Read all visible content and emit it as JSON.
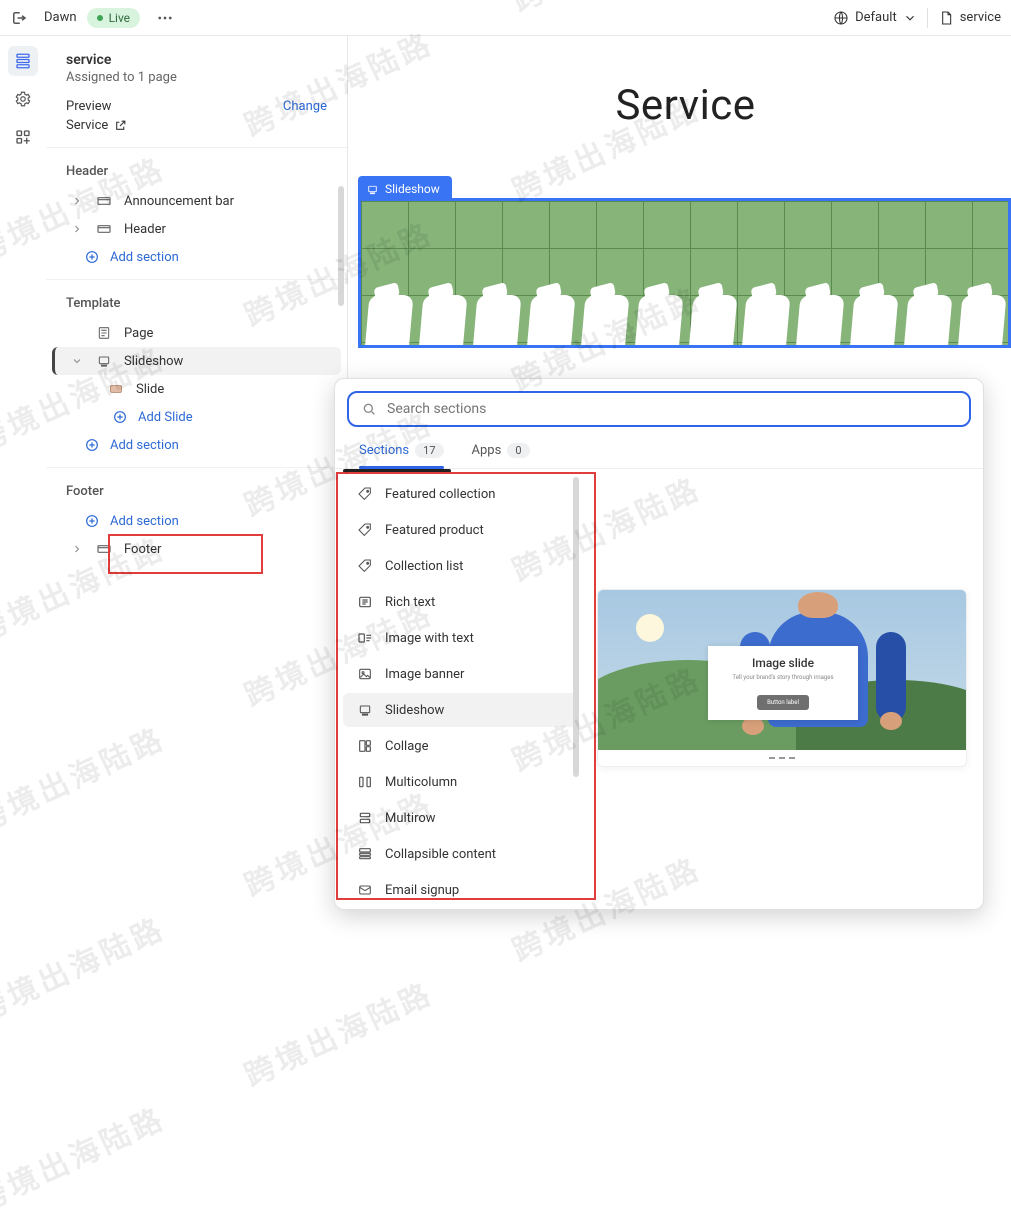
{
  "topbar": {
    "theme_name": "Dawn",
    "live_label": "Live",
    "locale_label": "Default",
    "doc_label": "service"
  },
  "sidebar": {
    "page": {
      "title": "service",
      "subtitle": "Assigned to 1 page",
      "preview_label": "Preview",
      "preview_value": "Service",
      "change_label": "Change"
    },
    "groups": {
      "header": {
        "label": "Header",
        "items": [
          {
            "label": "Announcement bar"
          },
          {
            "label": "Header"
          }
        ],
        "add_label": "Add section"
      },
      "template": {
        "label": "Template",
        "items": [
          {
            "label": "Page"
          },
          {
            "label": "Slideshow",
            "expanded": true,
            "children": [
              {
                "label": "Slide"
              }
            ],
            "add_child_label": "Add Slide"
          }
        ],
        "add_label": "Add section"
      },
      "footer": {
        "label": "Footer",
        "add_label": "Add section",
        "items": [
          {
            "label": "Footer"
          }
        ]
      }
    }
  },
  "canvas": {
    "heading": "Service",
    "section_badge": "Slideshow"
  },
  "popover": {
    "search_placeholder": "Search sections",
    "tabs": {
      "sections": {
        "label": "Sections",
        "count": "17"
      },
      "apps": {
        "label": "Apps",
        "count": "0"
      }
    },
    "items": [
      "Featured collection",
      "Featured product",
      "Collection list",
      "Rich text",
      "Image with text",
      "Image banner",
      "Slideshow",
      "Collage",
      "Multicolumn",
      "Multirow",
      "Collapsible content",
      "Email signup"
    ],
    "preview": {
      "title": "Image slide",
      "caption": "Tell your brand's story through images",
      "button": "Button label"
    }
  },
  "watermark_text": "跨境出海陆路"
}
